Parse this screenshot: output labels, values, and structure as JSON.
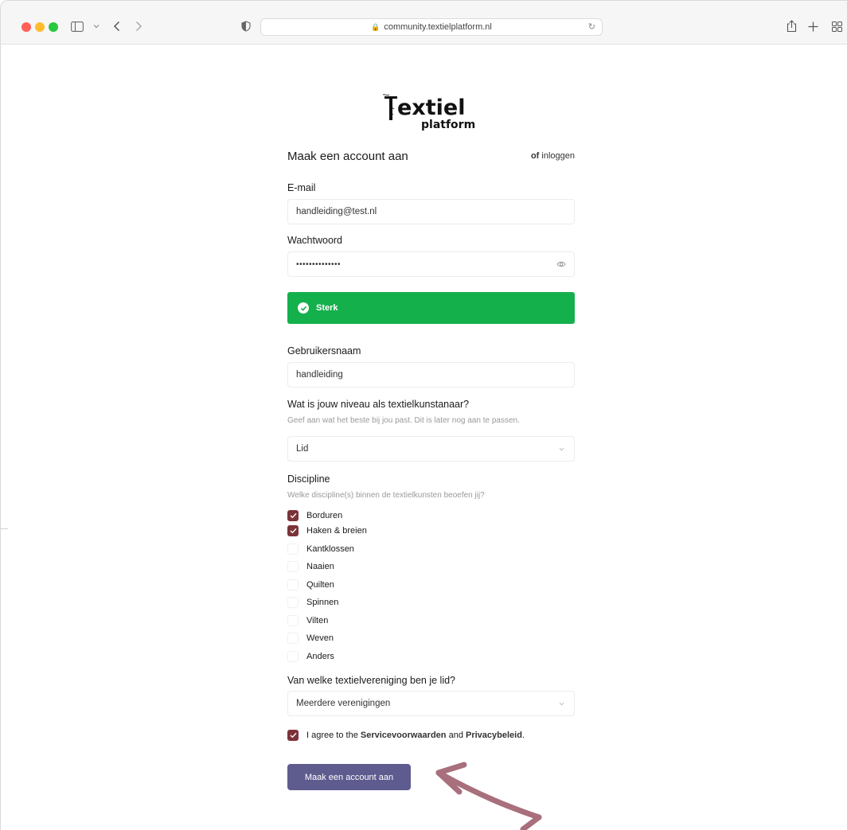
{
  "browser": {
    "url": "community.textielplatform.nl"
  },
  "logo": {
    "line1": "extiel",
    "line2": "platform",
    "brand_text": "Textiel platform"
  },
  "form": {
    "title": "Maak een account aan",
    "or_text": "of",
    "login_link": "inloggen",
    "email": {
      "label": "E-mail",
      "value": "handleiding@test.nl"
    },
    "password": {
      "label": "Wachtwoord",
      "value": "••••••••••••••"
    },
    "strength": {
      "label": "Sterk",
      "color": "#14b04b"
    },
    "username": {
      "label": "Gebruikersnaam",
      "value": "handleiding"
    },
    "level": {
      "label": "Wat is jouw niveau als textielkunstanaar?",
      "help": "Geef aan wat het beste bij jou past. Dit is later nog aan te passen.",
      "value": "Lid"
    },
    "discipline": {
      "label": "Discipline",
      "help": "Welke discipline(s) binnen de textielkunsten beoefen jij?",
      "options": [
        {
          "label": "Borduren",
          "checked": true
        },
        {
          "label": "Haken & breien",
          "checked": true
        },
        {
          "label": "Kantklossen",
          "checked": false
        },
        {
          "label": "Naaien",
          "checked": false
        },
        {
          "label": "Quilten",
          "checked": false
        },
        {
          "label": "Spinnen",
          "checked": false
        },
        {
          "label": "Vilten",
          "checked": false
        },
        {
          "label": "Weven",
          "checked": false
        },
        {
          "label": "Anders",
          "checked": false
        }
      ]
    },
    "association": {
      "label": "Van welke textielvereniging ben je lid?",
      "value": "Meerdere verenigingen"
    },
    "agree": {
      "prefix": "I agree to the",
      "terms": "Servicevoorwaarden",
      "and": "and",
      "privacy": "Privacybeleid",
      "suffix": ".",
      "checked": true
    },
    "submit_label": "Maak een account aan"
  },
  "colors": {
    "checkbox": "#7b3339",
    "submit": "#5e5b8f",
    "arrow": "#a86f7c"
  }
}
